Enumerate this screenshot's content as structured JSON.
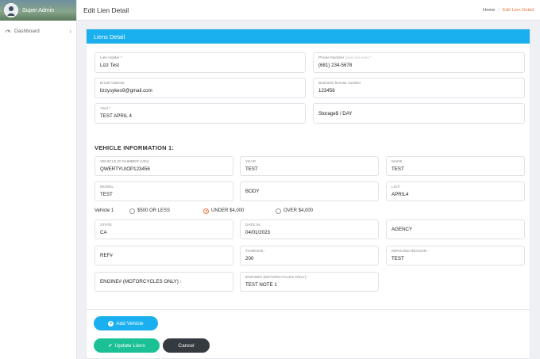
{
  "sidebar": {
    "user_name": "Super Admin",
    "items": [
      {
        "label": "Dashboard",
        "icon": "dashboard-icon"
      }
    ]
  },
  "header": {
    "title": "Edit Lien Detail",
    "breadcrumb": {
      "home": "Home",
      "current": "Edit Lien Detail"
    }
  },
  "card": {
    "title": "Liens Detail"
  },
  "lien_fields": {
    "lien_holder": {
      "label": "Lien Holder *",
      "value": "Lizz Test"
    },
    "phone": {
      "label": "Phone Number",
      "hint": "(xxx) xxx-xxxx *",
      "value": "(681) 234-5678"
    },
    "email": {
      "label": "Email Address",
      "value": "lizzysykes9@gmail.com"
    },
    "business_license": {
      "label": "Business license number",
      "value": "123456"
    },
    "yard": {
      "label": "Yard *",
      "value": "TEST APRIL 4"
    },
    "storage": {
      "value": "Storage$ / DAY"
    }
  },
  "vehicle": {
    "section_title": "VEHICLE INFORMATION 1:",
    "vin": {
      "label": "VEHICLE ID NUMBER (VIN)",
      "value": "QWERTYUIOP123456"
    },
    "year": {
      "label": "YEAR",
      "value": "TEST"
    },
    "make": {
      "label": "MAKE",
      "value": "TEST"
    },
    "model": {
      "label": "MODEL",
      "value": "TEST"
    },
    "body": {
      "value": "BODY"
    },
    "lic": {
      "label": "LIC#",
      "value": "APRIL4"
    },
    "value_label": "Vehicle 1",
    "value_options": [
      "$500 OR LESS",
      "UNDER $4,000",
      "OVER $4,000"
    ],
    "value_selected": "UNDER $4,000",
    "state": {
      "label": "STATE",
      "value": "CA"
    },
    "date_in": {
      "label": "DATE IN",
      "value": "04/01/2023"
    },
    "agency": {
      "value": "AGENCY"
    },
    "ref": {
      "value": "REF#"
    },
    "towinge": {
      "label": "TOWINGE :",
      "value": "200"
    },
    "impound_reason": {
      "label": "IMPOUND REASON :",
      "value": "TEST"
    },
    "engine_empty": {
      "value": "ENGINE# (MOTORCYCLES ONLY) :"
    },
    "engine": {
      "label": "ENGINE# (MOTORCYCLES ONLY) :",
      "value": "TEST NOTE 1"
    }
  },
  "buttons": {
    "add_vehicle": "Add Vehicle",
    "update_liens": "Update Liens",
    "cancel": "Cancel"
  },
  "colors": {
    "accent": "#1ab0ef",
    "success": "#1bc194",
    "dark": "#343a40",
    "highlight": "#f0713c"
  }
}
